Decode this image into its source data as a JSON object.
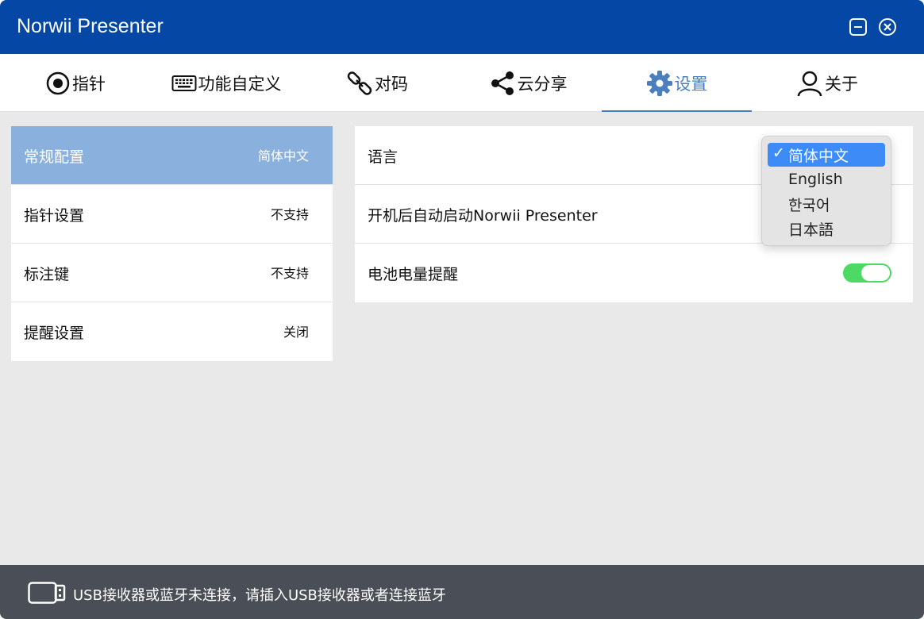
{
  "window": {
    "title": "Norwii Presenter"
  },
  "tabs": [
    {
      "label": "指针",
      "icon": "pointer-icon"
    },
    {
      "label": "功能自定义",
      "icon": "keyboard-icon"
    },
    {
      "label": "对码",
      "icon": "link-icon"
    },
    {
      "label": "云分享",
      "icon": "share-icon"
    },
    {
      "label": "设置",
      "icon": "gear-icon",
      "active": true
    },
    {
      "label": "关于",
      "icon": "user-icon"
    }
  ],
  "left_menu": [
    {
      "label": "常规配置",
      "value": "简体中文",
      "active": true
    },
    {
      "label": "指针设置",
      "value": "不支持"
    },
    {
      "label": "标注键",
      "value": "不支持"
    },
    {
      "label": "提醒设置",
      "value": "关闭"
    }
  ],
  "settings": {
    "language_label": "语言",
    "autostart_label": "开机后自动启动Norwii Presenter",
    "battery_label": "电池电量提醒",
    "battery_enabled": true
  },
  "language_dropdown": {
    "check_glyph": "✓",
    "options": [
      "简体中文",
      "English",
      "한국어",
      "日本語"
    ],
    "selected": "简体中文"
  },
  "status": {
    "message": "USB接收器或蓝牙未连接，请插入USB接收器或者连接蓝牙"
  },
  "colors": {
    "titlebar": "#0447a5",
    "accent": "#4a7ebf",
    "left_active": "#8ab1dd",
    "toggle_on": "#4cd964",
    "dropdown_selected": "#3d8bf7",
    "statusbar": "#4a4e57"
  }
}
